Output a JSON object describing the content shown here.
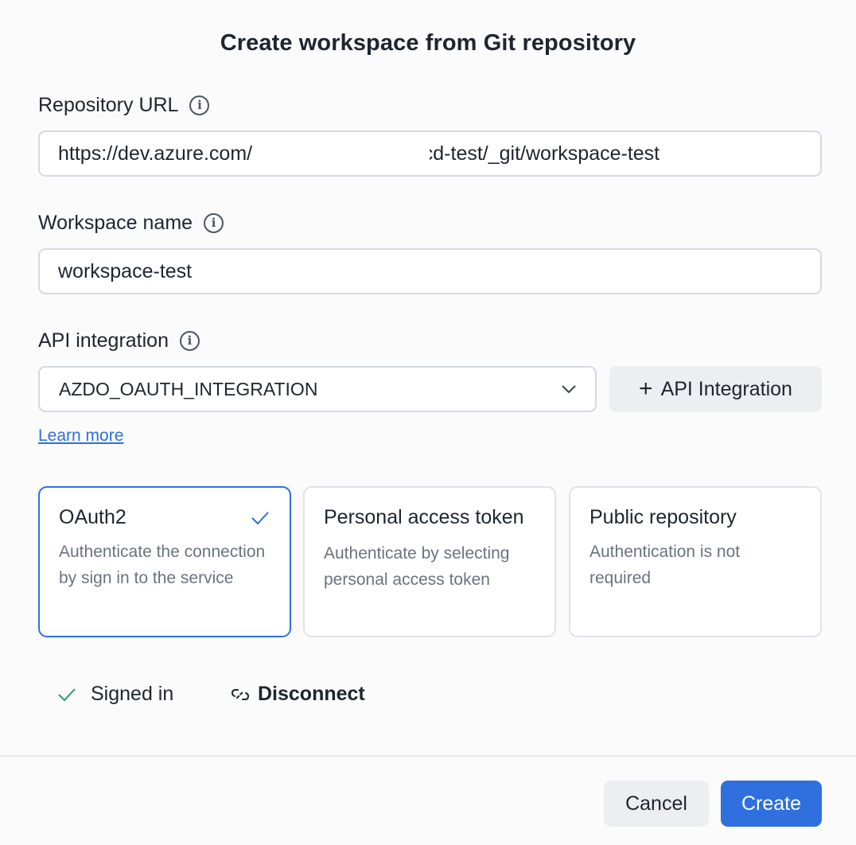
{
  "dialog": {
    "title": "Create workspace from Git repository"
  },
  "repository": {
    "label": "Repository URL",
    "value_prefix": "https://dev.azure.com/",
    "value_suffix": "/snow-cicd-test/_git/workspace-test"
  },
  "workspace": {
    "label": "Workspace name",
    "value": "workspace-test"
  },
  "api": {
    "label": "API integration",
    "selected": "AZDO_OAUTH_INTEGRATION",
    "add_label": "API Integration",
    "learn_more": "Learn more"
  },
  "auth_options": [
    {
      "title": "OAuth2",
      "description": "Authenticate the connection by sign in to the service",
      "selected": true
    },
    {
      "title": "Personal access token",
      "description": "Authenticate by selecting personal access token",
      "selected": false
    },
    {
      "title": "Public repository",
      "description": "Authentication is not required",
      "selected": false
    }
  ],
  "status": {
    "signed_in": "Signed in",
    "disconnect": "Disconnect"
  },
  "footer": {
    "cancel": "Cancel",
    "create": "Create"
  },
  "colors": {
    "accent": "#2f6fde",
    "success": "#2e9b6a"
  }
}
